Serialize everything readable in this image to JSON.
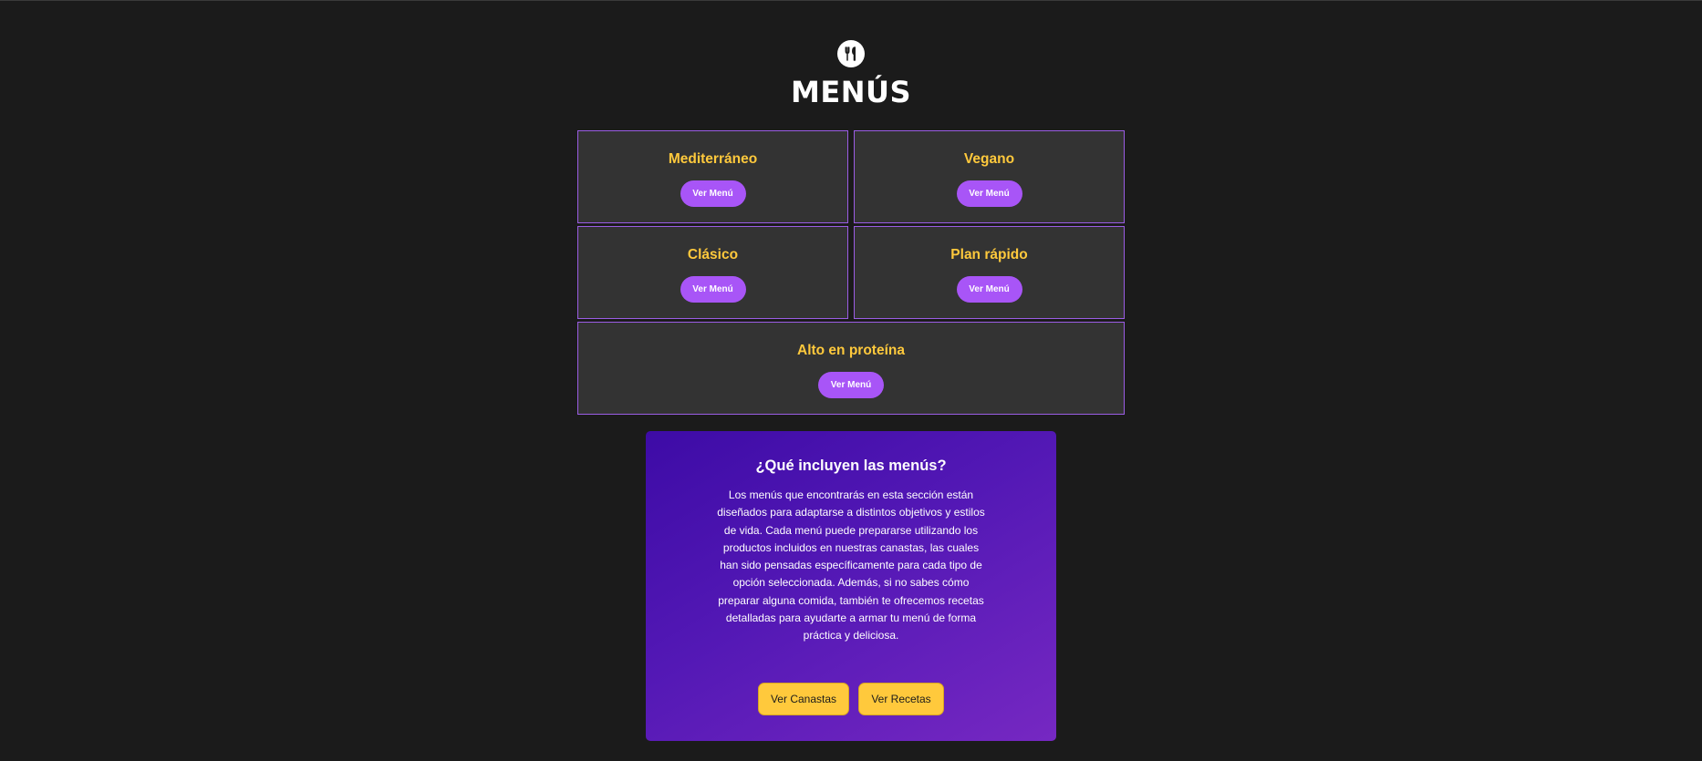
{
  "header": {
    "logo_icon": "fork-knife-icon",
    "title": "MENÚS"
  },
  "menus": [
    {
      "name": "Mediterráneo",
      "button": "Ver Menú"
    },
    {
      "name": "Vegano",
      "button": "Ver Menú"
    },
    {
      "name": "Clásico",
      "button": "Ver Menú"
    },
    {
      "name": "Plan rápido",
      "button": "Ver Menú"
    },
    {
      "name": "Alto en proteína",
      "button": "Ver Menú"
    }
  ],
  "info": {
    "title": "¿Qué incluyen las menús?",
    "text": "Los menús que encontrarás en esta sección están diseñados para adaptarse a distintos objetivos y estilos de vida. Cada menú puede prepararse utilizando los productos incluidos en nuestras canastas, las cuales han sido pensadas específicamente para cada tipo de opción seleccionada. Además, si no sabes cómo preparar alguna comida, también te ofrecemos recetas detalladas para ayudarte a armar tu menú de forma práctica y deliciosa.",
    "buttons": {
      "canastas": "Ver Canastas",
      "recetas": "Ver Recetas"
    }
  },
  "colors": {
    "background": "#1b1b1b",
    "card": "#333333",
    "card_border": "#9b5de5",
    "accent_purple": "#a855f7",
    "accent_yellow": "#ffc93c"
  }
}
